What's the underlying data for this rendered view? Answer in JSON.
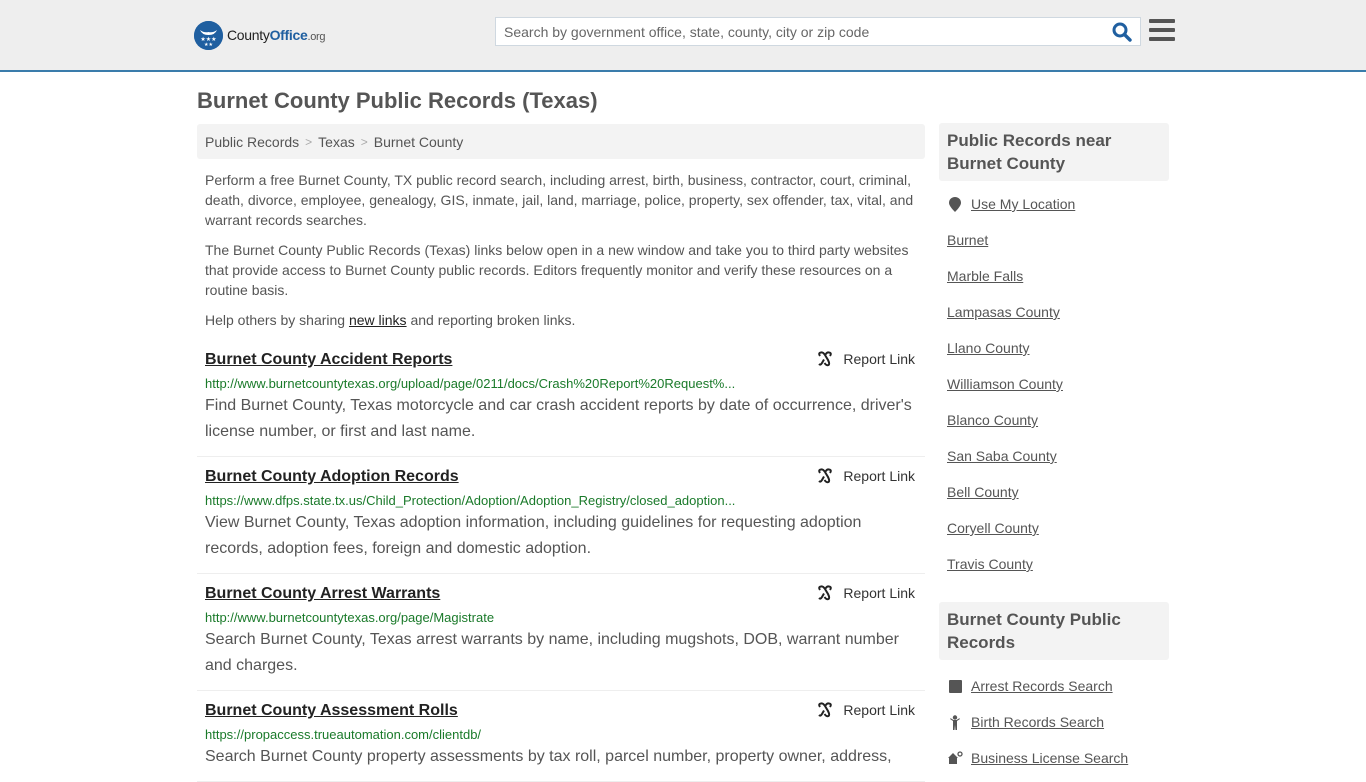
{
  "header": {
    "logo": {
      "name": "County",
      "name_bold": "Office",
      "tld": ".org",
      "brand_color": "#1f5fa0"
    },
    "search": {
      "placeholder": "Search by government office, state, county, city or zip code",
      "value": ""
    },
    "accent_color": "#3a7cab"
  },
  "page": {
    "title": "Burnet County Public Records (Texas)",
    "breadcrumb": [
      "Public Records",
      "Texas",
      "Burnet County"
    ],
    "intro": [
      "Perform a free Burnet County, TX public record search, including arrest, birth, business, contractor, court, criminal, death, divorce, employee, genealogy, GIS, inmate, jail, land, marriage, police, property, sex offender, tax, vital, and warrant records searches.",
      "The Burnet County Public Records (Texas) links below open in a new window and take you to third party websites that provide access to Burnet County public records. Editors frequently monitor and verify these resources on a routine basis."
    ],
    "help": {
      "before": "Help others by sharing ",
      "link": "new links",
      "after": " and reporting broken links."
    }
  },
  "records": [
    {
      "title": "Burnet County Accident Reports",
      "url": "http://www.burnetcountytexas.org/upload/page/0211/docs/Crash%20Report%20Request%...",
      "description": "Find Burnet County, Texas motorcycle and car crash accident reports by date of occurrence, driver's license number, or first and last name.",
      "report_label": "Report Link"
    },
    {
      "title": "Burnet County Adoption Records",
      "url": "https://www.dfps.state.tx.us/Child_Protection/Adoption/Adoption_Registry/closed_adoption...",
      "description": "View Burnet County, Texas adoption information, including guidelines for requesting adoption records, adoption fees, foreign and domestic adoption.",
      "report_label": "Report Link"
    },
    {
      "title": "Burnet County Arrest Warrants",
      "url": "http://www.burnetcountytexas.org/page/Magistrate",
      "description": "Search Burnet County, Texas arrest warrants by name, including mugshots, DOB, warrant number and charges.",
      "report_label": "Report Link"
    },
    {
      "title": "Burnet County Assessment Rolls",
      "url": "https://propaccess.trueautomation.com/clientdb/",
      "description": "Search Burnet County property assessments by tax roll, parcel number, property owner, address,",
      "report_label": "Report Link"
    }
  ],
  "sidebar": {
    "nearby": {
      "heading": "Public Records near Burnet County",
      "use_location": "Use My Location",
      "items": [
        "Burnet",
        "Marble Falls",
        "Lampasas County",
        "Llano County",
        "Williamson County",
        "Blanco County",
        "San Saba County",
        "Bell County",
        "Coryell County",
        "Travis County"
      ]
    },
    "county_records": {
      "heading": "Burnet County Public Records",
      "items": [
        {
          "label": "Arrest Records Search",
          "icon": "square-icon"
        },
        {
          "label": "Birth Records Search",
          "icon": "baby-icon"
        },
        {
          "label": "Business License Search",
          "icon": "business-icon"
        }
      ]
    }
  }
}
